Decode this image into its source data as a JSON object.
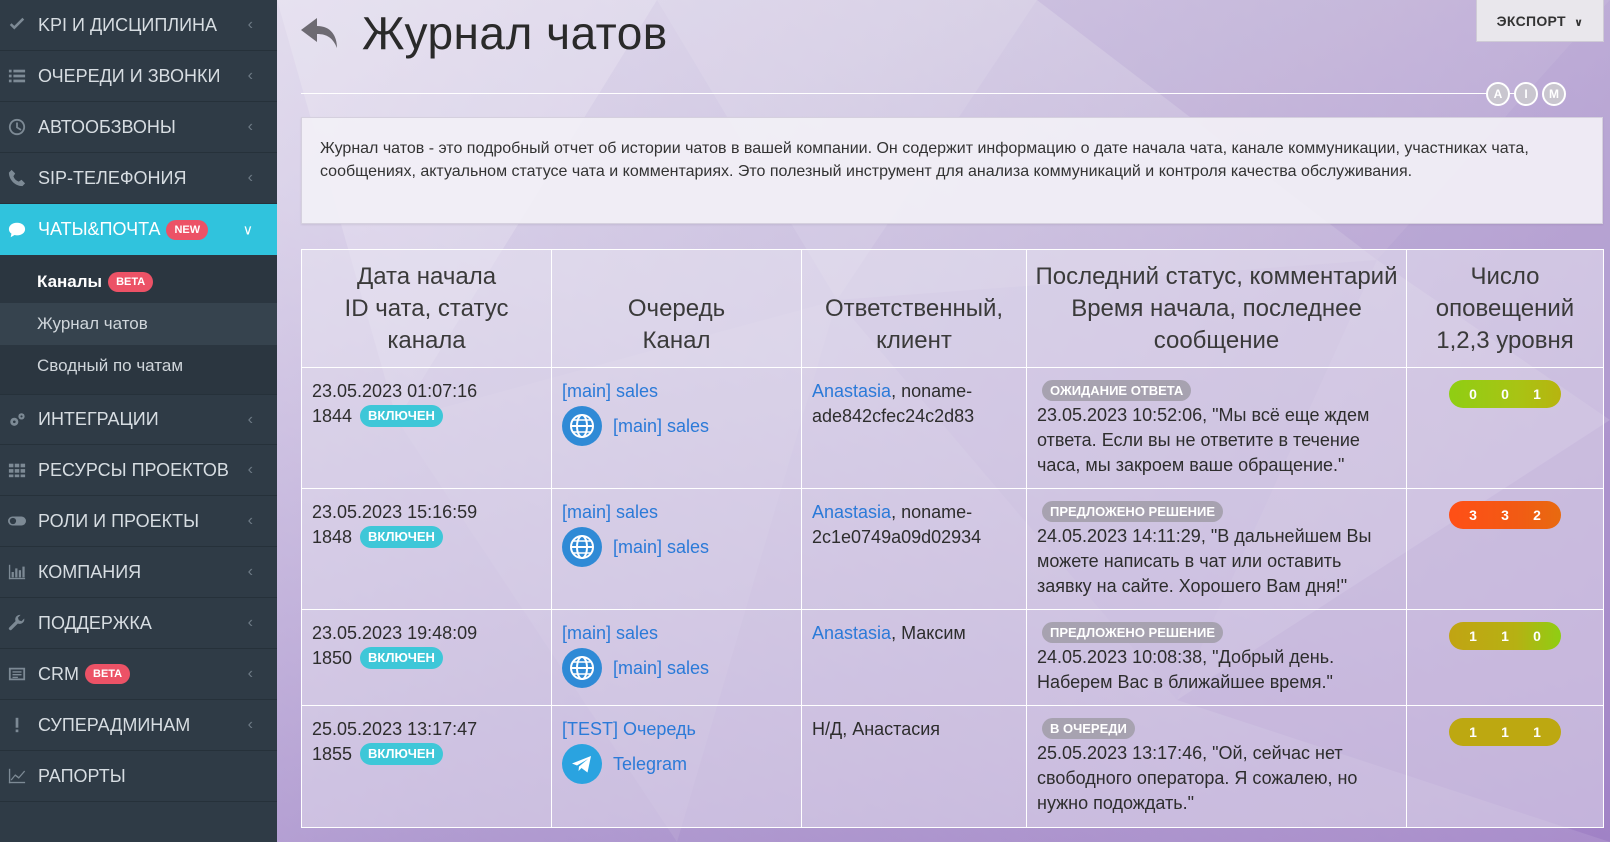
{
  "sidebar": {
    "items": [
      {
        "label": "KPI И ДИСЦИПЛИНА",
        "icon": "check-icon"
      },
      {
        "label": "ОЧЕРЕДИ И ЗВОНКИ",
        "icon": "list-icon"
      },
      {
        "label": "АВТООБЗВОНЫ",
        "icon": "clock-icon"
      },
      {
        "label": "SIP-ТЕЛЕФОНИЯ",
        "icon": "phone-icon"
      },
      {
        "label": "ЧАТЫ&ПОЧТА",
        "icon": "chat-icon",
        "badge": "NEW",
        "active": true
      },
      {
        "label": "ИНТЕГРАЦИИ",
        "icon": "gears-icon"
      },
      {
        "label": "РЕСУРСЫ ПРОЕКТОВ",
        "icon": "grid-icon"
      },
      {
        "label": "РОЛИ И ПРОЕКТЫ",
        "icon": "toggle-icon"
      },
      {
        "label": "КОМПАНИЯ",
        "icon": "bar-chart-icon"
      },
      {
        "label": "ПОДДЕРЖКА",
        "icon": "wrench-icon"
      },
      {
        "label": "CRM",
        "icon": "card-icon",
        "badge": "BETA"
      },
      {
        "label": "СУПЕРАДМИНАМ",
        "icon": "exclamation-icon"
      },
      {
        "label": "РАПОРТЫ",
        "icon": "line-chart-icon"
      }
    ],
    "submenu": [
      {
        "label": "Каналы",
        "badge": "BETA"
      },
      {
        "label": "Журнал чатов"
      },
      {
        "label": "Сводный по чатам"
      }
    ]
  },
  "header": {
    "title": "Журнал чатов",
    "export_label": "ЭКСПОРТ",
    "aim": [
      "A",
      "I",
      "M"
    ]
  },
  "description": "Журнал чатов - это подробный отчет об истории чатов в вашей компании. Он содержит информацию о дате начала чата, канале коммуникации, участниках чата, сообщениях, актуальном статусе чата и комментариях. Это полезный инструмент для анализа коммуникаций и контроля качества обслуживания.",
  "table": {
    "headers": [
      [
        "Дата начала",
        "ID чата, статус канала"
      ],
      [
        "Очередь",
        "Канал"
      ],
      [
        "Ответственный,",
        "клиент"
      ],
      [
        "Последний статус, комментарий",
        "Время начала, последнее",
        "сообщение"
      ],
      [
        "Число",
        "оповещений",
        "1,2,3 уровня"
      ]
    ],
    "rows": [
      {
        "date": "23.05.2023 01:07:16",
        "id": "1844",
        "channel_status": "ВКЛЮЧЕН",
        "queue": "[main] sales",
        "channel": "[main] sales",
        "channel_icon": "globe-icon",
        "responsible": "Anastasia",
        "client": ", noname-ade842cfec24c2d83",
        "status": "ОЖИДАНИЕ ОТВЕТА",
        "comment": "23.05.2023 10:52:06, \"Мы всё еще ждем ответа. Если вы не ответите в течение часа, мы закроем ваше обращение.\"",
        "alerts": [
          "0",
          "0",
          "1"
        ],
        "alerts_color": "#8fce13"
      },
      {
        "date": "23.05.2023 15:16:59",
        "id": "1848",
        "channel_status": "ВКЛЮЧЕН",
        "queue": "[main] sales",
        "channel": "[main] sales",
        "channel_icon": "globe-icon",
        "responsible": "Anastasia",
        "client": ", noname-2c1e0749a09d02934",
        "status": "ПРЕДЛОЖЕНО РЕШЕНИЕ",
        "comment": "24.05.2023 14:11:29, \"В дальнейшем Вы можете написать в чат или оставить заявку на сайте. Хорошего Вам дня!\"",
        "alerts": [
          "3",
          "3",
          "2"
        ],
        "alerts_color": "#ff4f16"
      },
      {
        "date": "23.05.2023 19:48:09",
        "id": "1850",
        "channel_status": "ВКЛЮЧЕН",
        "queue": "[main] sales",
        "channel": "[main] sales",
        "channel_icon": "globe-icon",
        "responsible": "Anastasia",
        "client": ", Максим",
        "status": "ПРЕДЛОЖЕНО РЕШЕНИЕ",
        "comment": "24.05.2023 10:08:38, \"Добрый день. Наберем Вас в ближайшее время.\"",
        "alerts": [
          "1",
          "1",
          "0"
        ],
        "alerts_color": "#c1a413"
      },
      {
        "date": "25.05.2023 13:17:47",
        "id": "1855",
        "channel_status": "ВКЛЮЧЕН",
        "queue": "[TEST] Очередь",
        "channel": "Telegram",
        "channel_icon": "telegram-icon",
        "responsible": "",
        "client": "Н/Д, Анастасия",
        "status": "В ОЧЕРЕДИ",
        "comment": "25.05.2023 13:17:46, \"Ой, сейчас нет свободного оператора. Я сожалею, но нужно подождать.\"",
        "alerts": [
          "1",
          "1",
          "1"
        ],
        "alerts_color": "#bda811"
      }
    ]
  },
  "colors": {
    "sidebar_bg": "#2f3b46",
    "active": "#30c3dd",
    "link": "#2b7ad8",
    "badge_red": "#ec5266"
  }
}
